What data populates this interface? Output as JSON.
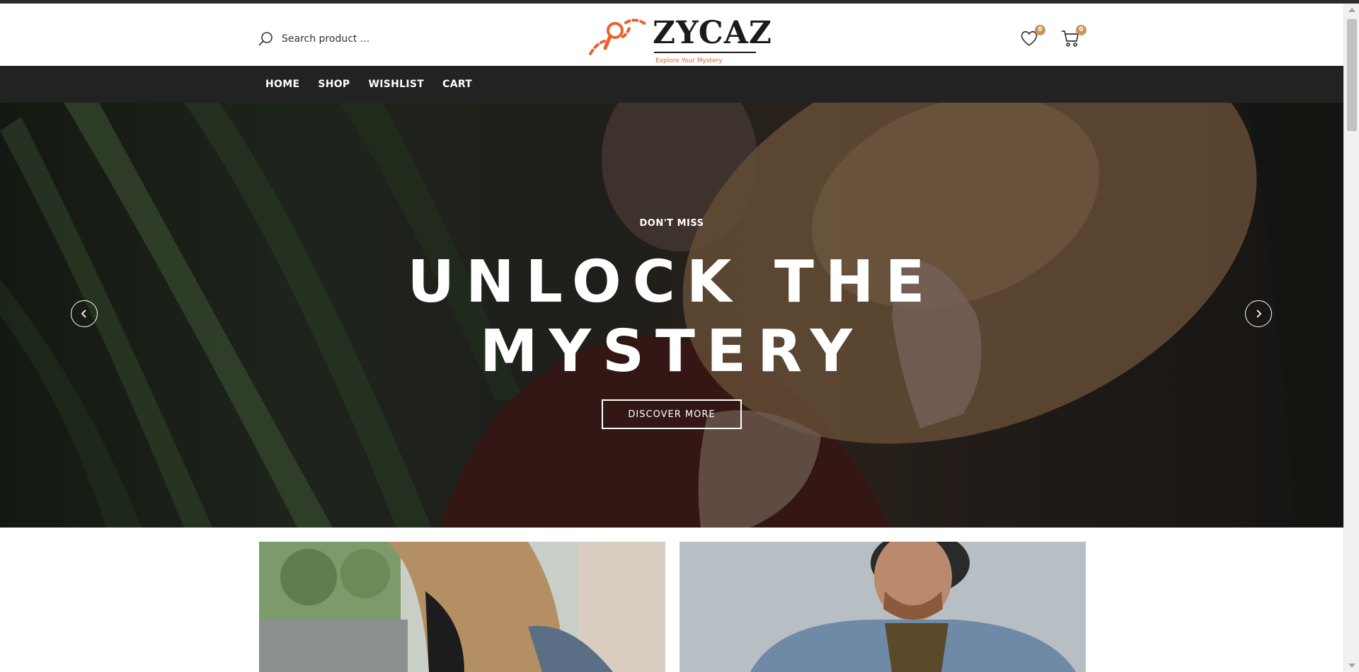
{
  "header": {
    "search": {
      "placeholder": "Search product ..."
    },
    "logo": {
      "name": "ZYCAZ",
      "tagline": "Explore Your Mystery"
    },
    "wishlist": {
      "count": "0"
    },
    "cart": {
      "count": "0"
    }
  },
  "nav": {
    "items": [
      {
        "label": "HOME"
      },
      {
        "label": "SHOP"
      },
      {
        "label": "WISHLIST"
      },
      {
        "label": "CART"
      }
    ]
  },
  "hero": {
    "eyebrow": "DON'T MISS",
    "title_line1": "UNLOCK THE",
    "title_line2": "MYSTERY",
    "button_label": "DISCOVER MORE"
  },
  "colors": {
    "accent": "#e8612c",
    "badge": "#c9935e",
    "nav_bg": "#222222"
  },
  "icons": [
    "search-icon",
    "heart-icon",
    "cart-icon",
    "chevron-left-icon",
    "chevron-right-icon"
  ]
}
